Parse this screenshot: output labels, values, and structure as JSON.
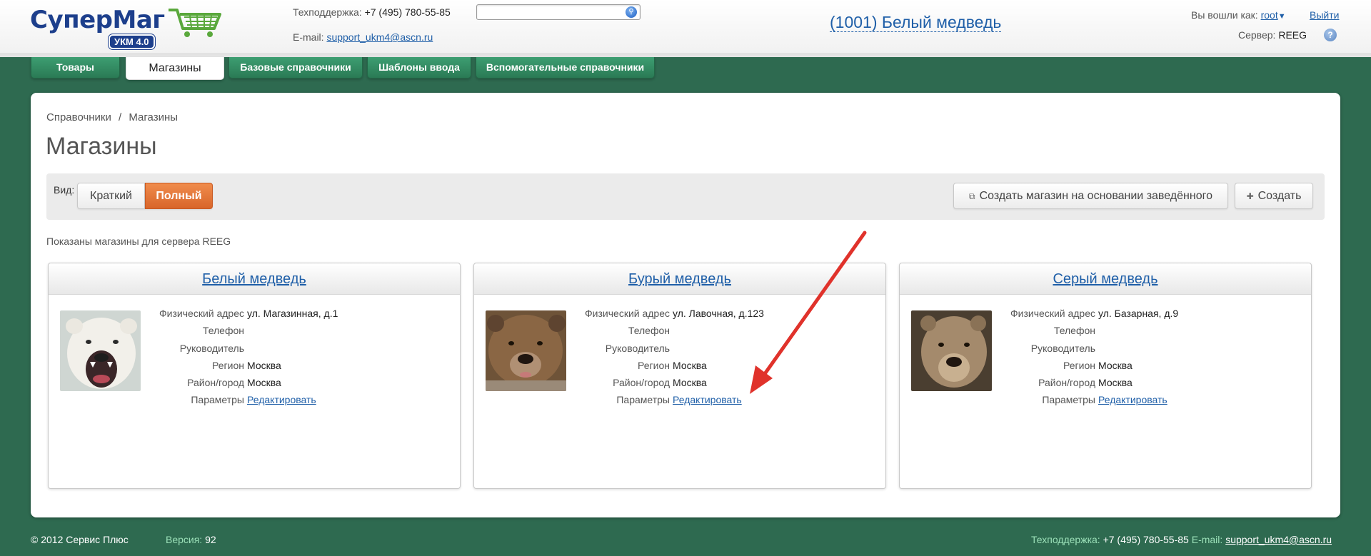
{
  "header": {
    "logo_text_1": "Супер",
    "logo_text_2": "Маг",
    "logo_badge": "УКМ 4.0",
    "support_label": "Техподдержка:",
    "support_phone": "+7 (495) 780-55-85",
    "email_label": "E-mail:",
    "email": "support_ukm4@ascn.ru",
    "search_value": "",
    "store_title": "(1001) Белый медведь",
    "login_label": "Вы вошли как:",
    "login_user": "root",
    "logout_label": "Выйти",
    "server_label": "Сервер:",
    "server_value": "REEG",
    "help_icon": "?"
  },
  "nav": {
    "tabs": [
      {
        "label": "Товары"
      },
      {
        "label": "Магазины",
        "active": true
      },
      {
        "label": "Базовые справочники"
      },
      {
        "label": "Шаблоны ввода"
      },
      {
        "label": "Вспомогательные справочники"
      }
    ]
  },
  "main": {
    "breadcrumb": [
      "Справочники",
      "Магазины"
    ],
    "breadcrumb_sep": "/",
    "title": "Магазины",
    "view_label": "Вид:",
    "view_short": "Краткий",
    "view_full": "Полный",
    "clone_button": "Создать магазин на основании заведённого",
    "create_button": "Создать",
    "stores_note": "Показаны магазины для сервера REEG"
  },
  "field_labels": {
    "address": "Физический адрес",
    "phone": "Телефон",
    "manager": "Руководитель",
    "region": "Регион",
    "district": "Район/город",
    "params": "Параметры"
  },
  "stores": [
    {
      "name": "Белый медведь",
      "address": "ул. Магазинная, д.1",
      "phone": "",
      "manager": "",
      "region": "Москва",
      "district": "Москва",
      "params_link": "Редактировать",
      "photo": "polar-bear-photo"
    },
    {
      "name": "Бурый медведь",
      "address": "ул. Лавочная, д.123",
      "phone": "",
      "manager": "",
      "region": "Москва",
      "district": "Москва",
      "params_link": "Редактировать",
      "photo": "brown-bear-photo"
    },
    {
      "name": "Серый медведь",
      "address": "ул. Базарная, д.9",
      "phone": "",
      "manager": "",
      "region": "Москва",
      "district": "Москва",
      "params_link": "Редактировать",
      "photo": "grey-bear-photo"
    }
  ],
  "footer": {
    "copyright": "© 2012 Сервис Плюс",
    "version_label": "Версия:",
    "version_value": "92",
    "support_label": "Техподдержка:",
    "support_phone": "+7 (495) 780-55-85",
    "email_label": "E-mail:",
    "email": "support_ukm4@ascn.ru"
  },
  "colors": {
    "background": "#2e6a50",
    "nav_tab": "#2a7a55",
    "active_view": "#e2753a",
    "link": "#1f5fa8",
    "arrow": "#e0322b"
  }
}
